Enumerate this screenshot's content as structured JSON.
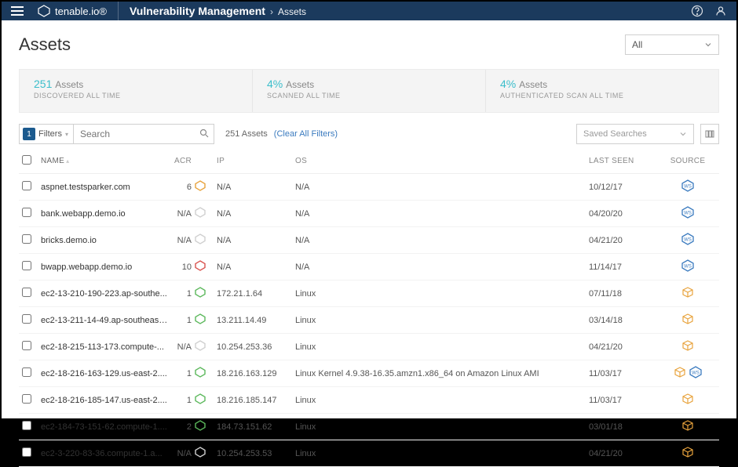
{
  "header": {
    "brand": "tenable.io®",
    "app": "Vulnerability Management",
    "page": "Assets"
  },
  "page": {
    "title": "Assets",
    "scope": "All"
  },
  "stats": [
    {
      "value": "251",
      "label": "Assets",
      "sub": "DISCOVERED ALL TIME"
    },
    {
      "value": "4%",
      "label": "Assets",
      "sub": "SCANNED ALL TIME"
    },
    {
      "value": "4%",
      "label": "Assets",
      "sub": "AUTHENTICATED SCAN ALL TIME"
    }
  ],
  "toolbar": {
    "filter_count": "1",
    "filter_label": "Filters",
    "search_placeholder": "Search",
    "result_count": "251 Assets",
    "clear_label": "(Clear All Filters)",
    "saved_searches": "Saved Searches"
  },
  "columns": {
    "name": "NAME",
    "acr": "ACR",
    "ip": "IP",
    "os": "OS",
    "last_seen": "LAST SEEN",
    "source": "SOURCE"
  },
  "severity_colors": {
    "med": "#e8a33d",
    "high": "#d9534f",
    "low": "#5cb85c",
    "none": "#cfcfcf"
  },
  "source_colors": {
    "ws": "#3b7bbf",
    "cube": "#e8a33d"
  },
  "assets": [
    {
      "name": "aspnet.testsparker.com",
      "acr": "6",
      "sev": "med",
      "ip": "N/A",
      "os": "N/A",
      "last_seen": "10/12/17",
      "sources": [
        "ws"
      ]
    },
    {
      "name": "bank.webapp.demo.io",
      "acr": "N/A",
      "sev": "none",
      "ip": "N/A",
      "os": "N/A",
      "last_seen": "04/20/20",
      "sources": [
        "ws"
      ]
    },
    {
      "name": "bricks.demo.io",
      "acr": "N/A",
      "sev": "none",
      "ip": "N/A",
      "os": "N/A",
      "last_seen": "04/21/20",
      "sources": [
        "ws"
      ]
    },
    {
      "name": "bwapp.webapp.demo.io",
      "acr": "10",
      "sev": "high",
      "ip": "N/A",
      "os": "N/A",
      "last_seen": "11/14/17",
      "sources": [
        "ws"
      ]
    },
    {
      "name": "ec2-13-210-190-223.ap-southe...",
      "acr": "1",
      "sev": "low",
      "ip": "172.21.1.64",
      "os": "Linux",
      "last_seen": "07/11/18",
      "sources": [
        "cube"
      ]
    },
    {
      "name": "ec2-13-211-14-49.ap-southeast...",
      "acr": "1",
      "sev": "low",
      "ip": "13.211.14.49",
      "os": "Linux",
      "last_seen": "03/14/18",
      "sources": [
        "cube"
      ]
    },
    {
      "name": "ec2-18-215-113-173.compute-...",
      "acr": "N/A",
      "sev": "none",
      "ip": "10.254.253.36",
      "os": "Linux",
      "last_seen": "04/21/20",
      "sources": [
        "cube"
      ]
    },
    {
      "name": "ec2-18-216-163-129.us-east-2....",
      "acr": "1",
      "sev": "low",
      "ip": "18.216.163.129",
      "os": "Linux Kernel 4.9.38-16.35.amzn1.x86_64 on Amazon Linux AMI",
      "last_seen": "11/03/17",
      "sources": [
        "cube",
        "ws"
      ]
    },
    {
      "name": "ec2-18-216-185-147.us-east-2....",
      "acr": "1",
      "sev": "low",
      "ip": "18.216.185.147",
      "os": "Linux",
      "last_seen": "11/03/17",
      "sources": [
        "cube"
      ]
    },
    {
      "name": "ec2-184-73-151-62.compute-1....",
      "acr": "2",
      "sev": "low",
      "ip": "184.73.151.62",
      "os": "Linux",
      "last_seen": "03/01/18",
      "sources": [
        "cube"
      ]
    },
    {
      "name": "ec2-3-220-83-36.compute-1.a...",
      "acr": "N/A",
      "sev": "none",
      "ip": "10.254.253.53",
      "os": "Linux",
      "last_seen": "04/21/20",
      "sources": [
        "cube"
      ]
    }
  ]
}
